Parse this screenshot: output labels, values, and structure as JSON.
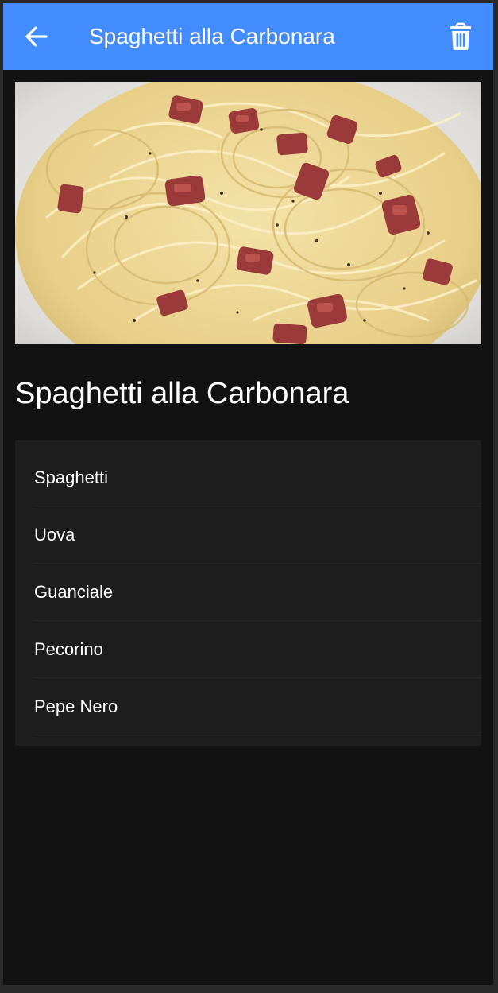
{
  "toolbar": {
    "back_icon": "arrow-back-icon",
    "title": "Spaghetti alla Carbonara",
    "delete_icon": "trash-icon",
    "background": "#428cff"
  },
  "recipe": {
    "image_alt": "spaghetti-carbonara-photo",
    "title": "Spaghetti alla Carbonara",
    "ingredients": [
      "Spaghetti",
      "Uova",
      "Guanciale",
      "Pecorino",
      "Pepe Nero"
    ]
  },
  "colors": {
    "accent": "#428cff",
    "background": "#121212",
    "list_background": "#1e1e1e",
    "text": "#ffffff"
  }
}
